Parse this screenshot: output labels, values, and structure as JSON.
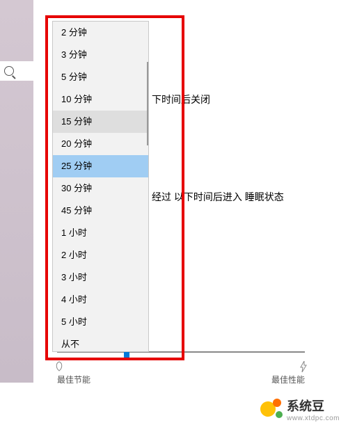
{
  "dropdown": {
    "items": [
      {
        "label": "2 分钟"
      },
      {
        "label": "3 分钟"
      },
      {
        "label": "5 分钟"
      },
      {
        "label": "10 分钟"
      },
      {
        "label": "15 分钟",
        "highlighted": true
      },
      {
        "label": "20 分钟"
      },
      {
        "label": "25 分钟",
        "selected": true
      },
      {
        "label": "30 分钟"
      },
      {
        "label": "45 分钟"
      },
      {
        "label": "1 小时"
      },
      {
        "label": "2 小时"
      },
      {
        "label": "3 小时"
      },
      {
        "label": "4 小时"
      },
      {
        "label": "5 小时"
      },
      {
        "label": "从不"
      }
    ]
  },
  "background": {
    "text1": "下时间后关闭",
    "text2": "经过 以下时间后进入 睡眠状态"
  },
  "slider": {
    "left_label": "最佳节能",
    "right_label": "最佳性能"
  },
  "watermark": {
    "name": "系统豆",
    "url": "www.xtdpc.com"
  }
}
